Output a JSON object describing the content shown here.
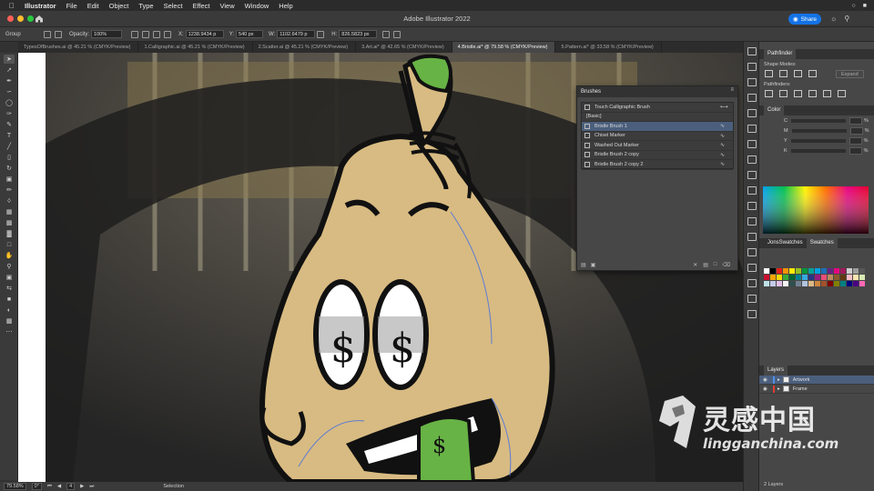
{
  "menubar": {
    "app": "Illustrator",
    "items": [
      "File",
      "Edit",
      "Object",
      "Type",
      "Select",
      "Effect",
      "View",
      "Window",
      "Help"
    ]
  },
  "titlebar": {
    "title": "Adobe Illustrator 2022",
    "share_label": "Share"
  },
  "controlbar": {
    "selection_label": "Group",
    "opacity_label": "Opacity:",
    "opacity_value": "100%",
    "x_label": "X:",
    "x_value": "1238.9434 p",
    "y_label": "Y:",
    "y_value": "540 px",
    "w_label": "W:",
    "w_value": "1102.6479 p",
    "h_label": "H:",
    "h_value": "826.5823 px"
  },
  "tabs": [
    {
      "label": "TypesOfBrushes.ai @ 45.21 % (CMYK/Preview)",
      "active": false
    },
    {
      "label": "1.Calligraphic.ai @ 45.21 % (CMYK/Preview)",
      "active": false
    },
    {
      "label": "2.Scatter.ai @ 45.21 % (CMYK/Preview)",
      "active": false
    },
    {
      "label": "3.Art.ai* @ 42.65 % (CMYK/Preview)",
      "active": false
    },
    {
      "label": "4.Bristle.ai* @ 79.58 % (CMYK/Preview)",
      "active": true
    },
    {
      "label": "5.Pattern.ai* @ 33.58 % (CMYK/Preview)",
      "active": false
    }
  ],
  "brushes_panel": {
    "title": "Brushes",
    "items": [
      {
        "name": "Touch Calligraphic Brush",
        "selected": false
      },
      {
        "name": "[Basic]",
        "selected": false
      },
      {
        "name": "Bristle Brush 1",
        "selected": true
      },
      {
        "name": "Chisel Marker",
        "selected": false
      },
      {
        "name": "Washed Out Marker",
        "selected": false
      },
      {
        "name": "Bristle Brush 2 copy",
        "selected": false
      },
      {
        "name": "Bristle Brush 2 copy 2",
        "selected": false
      }
    ]
  },
  "pathfinder": {
    "title": "Pathfinder",
    "shape_modes_label": "Shape Modes:",
    "pathfinders_label": "Pathfinders:",
    "expand_label": "Expand"
  },
  "color_panel": {
    "title": "Color",
    "channels": [
      {
        "name": "C",
        "unit": "%"
      },
      {
        "name": "M",
        "unit": "%"
      },
      {
        "name": "Y",
        "unit": "%"
      },
      {
        "name": "K",
        "unit": "%"
      }
    ]
  },
  "swatches_panel": {
    "tabs": [
      "JonsSwatches",
      "Swatches"
    ],
    "active_tab": "Swatches",
    "colors": [
      "#ffffff",
      "#000000",
      "#e2231a",
      "#f39200",
      "#ffed00",
      "#95c11f",
      "#009640",
      "#00a19a",
      "#009fe3",
      "#1d71b8",
      "#662483",
      "#e6007e",
      "#a2195b",
      "#cfcfcf",
      "#9d9d9c",
      "#575756",
      "#c8102e",
      "#f7a600",
      "#fdd900",
      "#3aaa35",
      "#006633",
      "#00808f",
      "#36a9e1",
      "#283583",
      "#951b81",
      "#e94e77",
      "#ba8a5c",
      "#8b5a2b",
      "#603913",
      "#f6bfc7",
      "#fce4b0",
      "#d9e9b2",
      "#bde0e6",
      "#c5cae9",
      "#e1bee7",
      "#f5f5f5",
      "#2f4f4f",
      "#708090",
      "#b0c4de",
      "#deb887",
      "#cd853f",
      "#a0522d",
      "#800000",
      "#808000",
      "#008080",
      "#000080",
      "#4b0082",
      "#ff69b4"
    ]
  },
  "layers_panel": {
    "title": "Layers",
    "layers": [
      {
        "name": "Artwork",
        "color": "#4f8fe8",
        "selected": true
      },
      {
        "name": "Frame",
        "color": "#e03c31",
        "selected": false
      }
    ],
    "count_label": "2 Layers"
  },
  "statusbar": {
    "zoom": "79.58%",
    "rotation": "0°",
    "artboard": "4",
    "tool": "Selection"
  },
  "watermark": {
    "cn": "灵感中国",
    "en": "lingganchina.com"
  },
  "colors": {
    "accent": "#1473e6",
    "selection_row": "#4b5f7d"
  }
}
